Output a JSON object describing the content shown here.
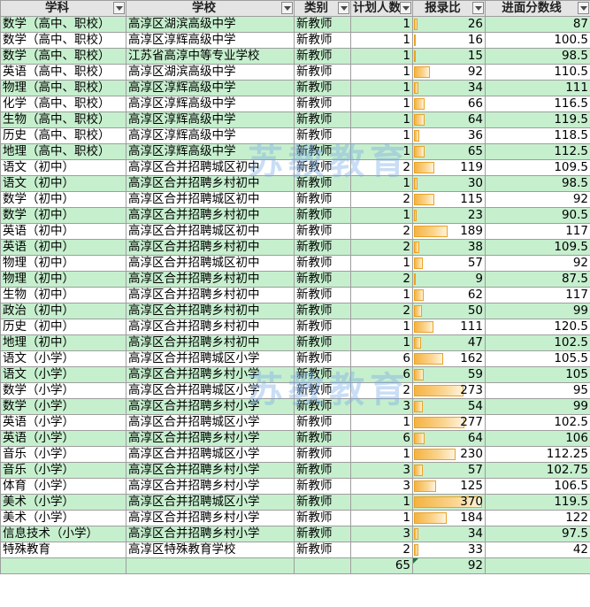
{
  "headers": [
    "学科",
    "学校",
    "类别",
    "计划人数",
    "报录比",
    "进面分数线"
  ],
  "watermark": "苏教教育",
  "bar_max": 380,
  "colors": {
    "row_band": "#c6efce",
    "header_bg": "#e4e4e4",
    "bar_fill": "#f5b342",
    "grid_line": "#9e9e9e"
  },
  "rows": [
    {
      "subject": "数学（高中、职校）",
      "school": "高淳区湖滨高级中学",
      "type": "新教师",
      "plan": "1",
      "ratio": "26",
      "score": "87"
    },
    {
      "subject": "数学（高中、职校）",
      "school": "高淳区淳辉高级中学",
      "type": "新教师",
      "plan": "1",
      "ratio": "16",
      "score": "100.5"
    },
    {
      "subject": "数学（高中、职校）",
      "school": "江苏省高淳中等专业学校",
      "type": "新教师",
      "plan": "1",
      "ratio": "15",
      "score": "98.5"
    },
    {
      "subject": "英语（高中、职校）",
      "school": "高淳区湖滨高级中学",
      "type": "新教师",
      "plan": "1",
      "ratio": "92",
      "score": "110.5"
    },
    {
      "subject": "物理（高中、职校）",
      "school": "高淳区淳辉高级中学",
      "type": "新教师",
      "plan": "1",
      "ratio": "34",
      "score": "111"
    },
    {
      "subject": "化学（高中、职校）",
      "school": "高淳区淳辉高级中学",
      "type": "新教师",
      "plan": "1",
      "ratio": "66",
      "score": "116.5"
    },
    {
      "subject": "生物（高中、职校）",
      "school": "高淳区淳辉高级中学",
      "type": "新教师",
      "plan": "1",
      "ratio": "64",
      "score": "119.5"
    },
    {
      "subject": "历史（高中、职校）",
      "school": "高淳区淳辉高级中学",
      "type": "新教师",
      "plan": "1",
      "ratio": "36",
      "score": "118.5"
    },
    {
      "subject": "地理（高中、职校）",
      "school": "高淳区淳辉高级中学",
      "type": "新教师",
      "plan": "1",
      "ratio": "65",
      "score": "112.5"
    },
    {
      "subject": "语文（初中）",
      "school": "高淳区合并招聘城区初中",
      "type": "新教师",
      "plan": "2",
      "ratio": "119",
      "score": "109.5"
    },
    {
      "subject": "语文（初中）",
      "school": "高淳区合并招聘乡村初中",
      "type": "新教师",
      "plan": "1",
      "ratio": "30",
      "score": "98.5"
    },
    {
      "subject": "数学（初中）",
      "school": "高淳区合并招聘城区初中",
      "type": "新教师",
      "plan": "2",
      "ratio": "115",
      "score": "92"
    },
    {
      "subject": "数学（初中）",
      "school": "高淳区合并招聘乡村初中",
      "type": "新教师",
      "plan": "1",
      "ratio": "23",
      "score": "90.5"
    },
    {
      "subject": "英语（初中）",
      "school": "高淳区合并招聘城区初中",
      "type": "新教师",
      "plan": "2",
      "ratio": "189",
      "score": "117"
    },
    {
      "subject": "英语（初中）",
      "school": "高淳区合并招聘乡村初中",
      "type": "新教师",
      "plan": "2",
      "ratio": "38",
      "score": "109.5"
    },
    {
      "subject": "物理（初中）",
      "school": "高淳区合并招聘城区初中",
      "type": "新教师",
      "plan": "1",
      "ratio": "57",
      "score": "92"
    },
    {
      "subject": "物理（初中）",
      "school": "高淳区合并招聘乡村初中",
      "type": "新教师",
      "plan": "2",
      "ratio": "9",
      "score": "87.5"
    },
    {
      "subject": "生物（初中）",
      "school": "高淳区合并招聘乡村初中",
      "type": "新教师",
      "plan": "1",
      "ratio": "62",
      "score": "117"
    },
    {
      "subject": "政治（初中）",
      "school": "高淳区合并招聘乡村初中",
      "type": "新教师",
      "plan": "2",
      "ratio": "50",
      "score": "99"
    },
    {
      "subject": "历史（初中）",
      "school": "高淳区合并招聘乡村初中",
      "type": "新教师",
      "plan": "1",
      "ratio": "111",
      "score": "120.5"
    },
    {
      "subject": "地理（初中）",
      "school": "高淳区合并招聘乡村初中",
      "type": "新教师",
      "plan": "1",
      "ratio": "47",
      "score": "102.5"
    },
    {
      "subject": "语文（小学）",
      "school": "高淳区合并招聘城区小学",
      "type": "新教师",
      "plan": "6",
      "ratio": "162",
      "score": "105.5"
    },
    {
      "subject": "语文（小学）",
      "school": "高淳区合并招聘乡村小学",
      "type": "新教师",
      "plan": "6",
      "ratio": "59",
      "score": "105"
    },
    {
      "subject": "数学（小学）",
      "school": "高淳区合并招聘城区小学",
      "type": "新教师",
      "plan": "2",
      "ratio": "273",
      "score": "95"
    },
    {
      "subject": "数学（小学）",
      "school": "高淳区合并招聘乡村小学",
      "type": "新教师",
      "plan": "3",
      "ratio": "54",
      "score": "99"
    },
    {
      "subject": "英语（小学）",
      "school": "高淳区合并招聘城区小学",
      "type": "新教师",
      "plan": "1",
      "ratio": "277",
      "score": "102.5"
    },
    {
      "subject": "英语（小学）",
      "school": "高淳区合并招聘乡村小学",
      "type": "新教师",
      "plan": "6",
      "ratio": "64",
      "score": "106"
    },
    {
      "subject": "音乐（小学）",
      "school": "高淳区合并招聘城区小学",
      "type": "新教师",
      "plan": "1",
      "ratio": "230",
      "score": "112.25"
    },
    {
      "subject": "音乐（小学）",
      "school": "高淳区合并招聘乡村小学",
      "type": "新教师",
      "plan": "3",
      "ratio": "57",
      "score": "102.75"
    },
    {
      "subject": "体育（小学）",
      "school": "高淳区合并招聘乡村小学",
      "type": "新教师",
      "plan": "3",
      "ratio": "125",
      "score": "106.5"
    },
    {
      "subject": "美术（小学）",
      "school": "高淳区合并招聘城区小学",
      "type": "新教师",
      "plan": "1",
      "ratio": "370",
      "score": "119.5"
    },
    {
      "subject": "美术（小学）",
      "school": "高淳区合并招聘乡村小学",
      "type": "新教师",
      "plan": "1",
      "ratio": "184",
      "score": "122"
    },
    {
      "subject": "信息技术（小学）",
      "school": "高淳区合并招聘乡村小学",
      "type": "新教师",
      "plan": "3",
      "ratio": "34",
      "score": "97.5"
    },
    {
      "subject": "特殊教育",
      "school": "高淳区特殊教育学校",
      "type": "新教师",
      "plan": "2",
      "ratio": "33",
      "score": "42"
    }
  ],
  "totals": {
    "plan": "65",
    "ratio": "92"
  }
}
